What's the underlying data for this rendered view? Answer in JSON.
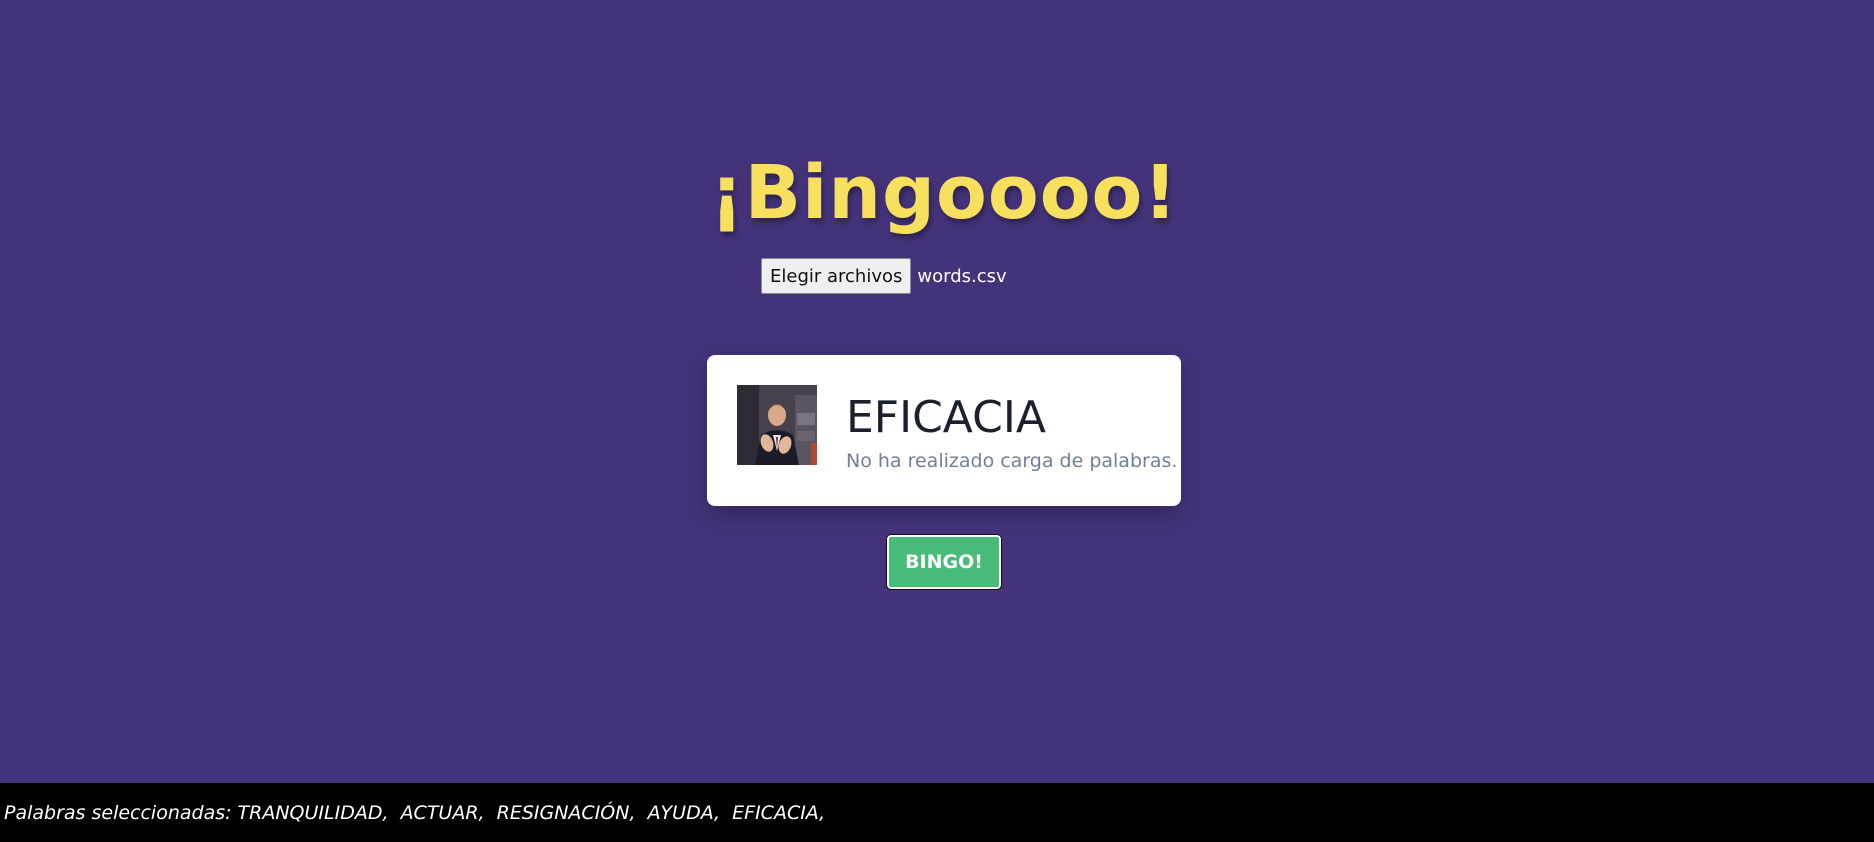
{
  "page": {
    "title": "¡Bingoooo!",
    "background_color": "#44337a",
    "title_color": "#f6e05e"
  },
  "file_input": {
    "button_label": "Elegir archivos",
    "file_name": "words.csv"
  },
  "card": {
    "word": "EFICACIA",
    "message": "No ha realizado carga de palabras.",
    "image": "clapping-man-gif"
  },
  "bingo_button": {
    "label": "BINGO!",
    "color": "#48bb78"
  },
  "footer": {
    "label": "Palabras seleccionadas:",
    "words": [
      "TRANQUILIDAD,",
      "ACTUAR,",
      "RESIGNACIÓN,",
      "AYUDA,",
      "EFICACIA,"
    ]
  }
}
